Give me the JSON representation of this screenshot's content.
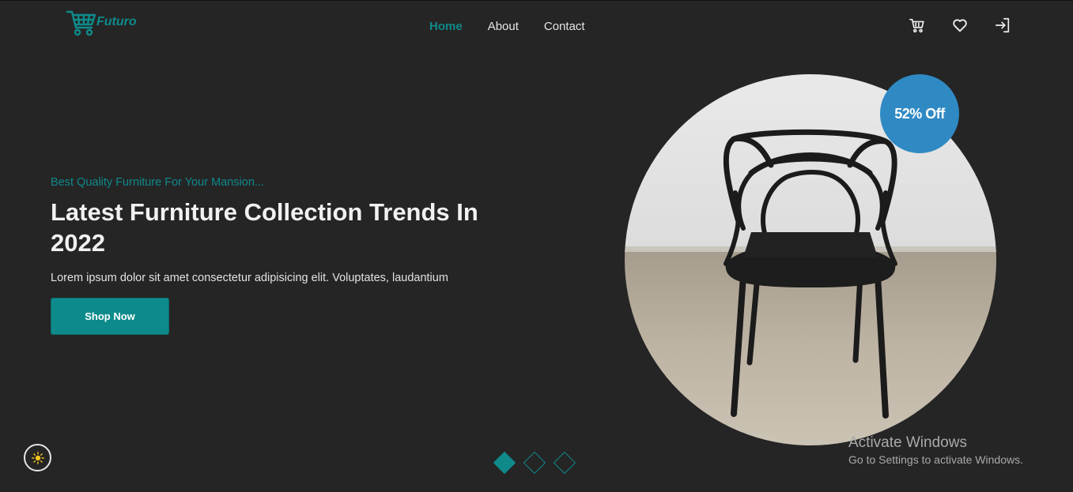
{
  "header": {
    "logo_text": "Futuro",
    "nav": [
      {
        "label": "Home",
        "active": true
      },
      {
        "label": "About",
        "active": false
      },
      {
        "label": "Contact",
        "active": false
      }
    ],
    "icons": [
      "cart-icon",
      "heart-icon",
      "login-icon"
    ]
  },
  "hero": {
    "subtitle": "Best Quality Furniture For Your Mansion...",
    "title": "Latest Furniture Collection Trends In 2022",
    "description": "Lorem ipsum dolor sit amet consectetur adipisicing elit. Voluptates, laudantium",
    "cta_label": "Shop Now",
    "discount": "52% Off",
    "image_alt": "black chair"
  },
  "slider": {
    "total": 3,
    "active_index": 0
  },
  "watermark": {
    "title": "Activate Windows",
    "subtitle": "Go to Settings to activate Windows."
  },
  "colors": {
    "accent": "#10898b",
    "badge": "#2f8ac4",
    "background": "#252525"
  }
}
